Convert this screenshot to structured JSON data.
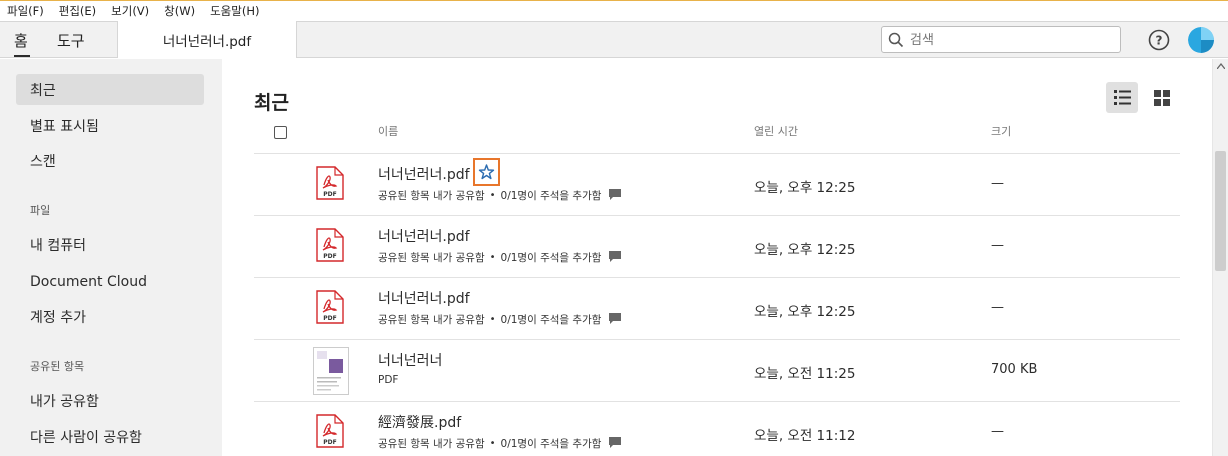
{
  "menu": [
    "파일(F)",
    "편집(E)",
    "보기(V)",
    "창(W)",
    "도움말(H)"
  ],
  "tabs": {
    "home": "홈",
    "tools": "도구",
    "document": "너너넌러너.pdf"
  },
  "search": {
    "placeholder": "검색",
    "value": ""
  },
  "sidebar": {
    "recent": "최근",
    "starred": "별표 표시됨",
    "scan": "스캔",
    "files_section": "파일",
    "my_computer": "내 컴퓨터",
    "document_cloud": "Document Cloud",
    "add_account": "계정 추가",
    "shared_section": "공유된 항목",
    "shared_by_me": "내가 공유함",
    "shared_by_others": "다른 사람이 공유함"
  },
  "main": {
    "title": "최근",
    "columns": {
      "name": "이름",
      "opened": "열린 시간",
      "size": "크기"
    }
  },
  "files": [
    {
      "name": "너너넌러너.pdf",
      "sub_shared": "공유된 항목 내가 공유함",
      "sub_comments": "0/1명이 주석을 추가함",
      "opened": "오늘, 오후 12:25",
      "size": "—",
      "icon": "pdf-icon",
      "starred_hover": true
    },
    {
      "name": "너너넌러너.pdf",
      "sub_shared": "공유된 항목 내가 공유함",
      "sub_comments": "0/1명이 주석을 추가함",
      "opened": "오늘, 오후 12:25",
      "size": "—",
      "icon": "pdf-icon"
    },
    {
      "name": "너너넌러너.pdf",
      "sub_shared": "공유된 항목 내가 공유함",
      "sub_comments": "0/1명이 주석을 추가함",
      "opened": "오늘, 오후 12:25",
      "size": "—",
      "icon": "pdf-icon"
    },
    {
      "name": "너너넌러너",
      "sub_type": "PDF",
      "opened": "오늘, 오전 11:25",
      "size": "700 KB",
      "icon": "thumbnail"
    },
    {
      "name": "經濟發展.pdf",
      "sub_shared": "공유된 항목 내가 공유함",
      "sub_comments": "0/1명이 주석을 추가함",
      "opened": "오늘, 오전 11:12",
      "size": "—",
      "icon": "pdf-icon"
    }
  ],
  "colors": {
    "accent_orange": "#e8762b",
    "pdf_red": "#d4282b",
    "star_blue": "#2b6cb0"
  }
}
